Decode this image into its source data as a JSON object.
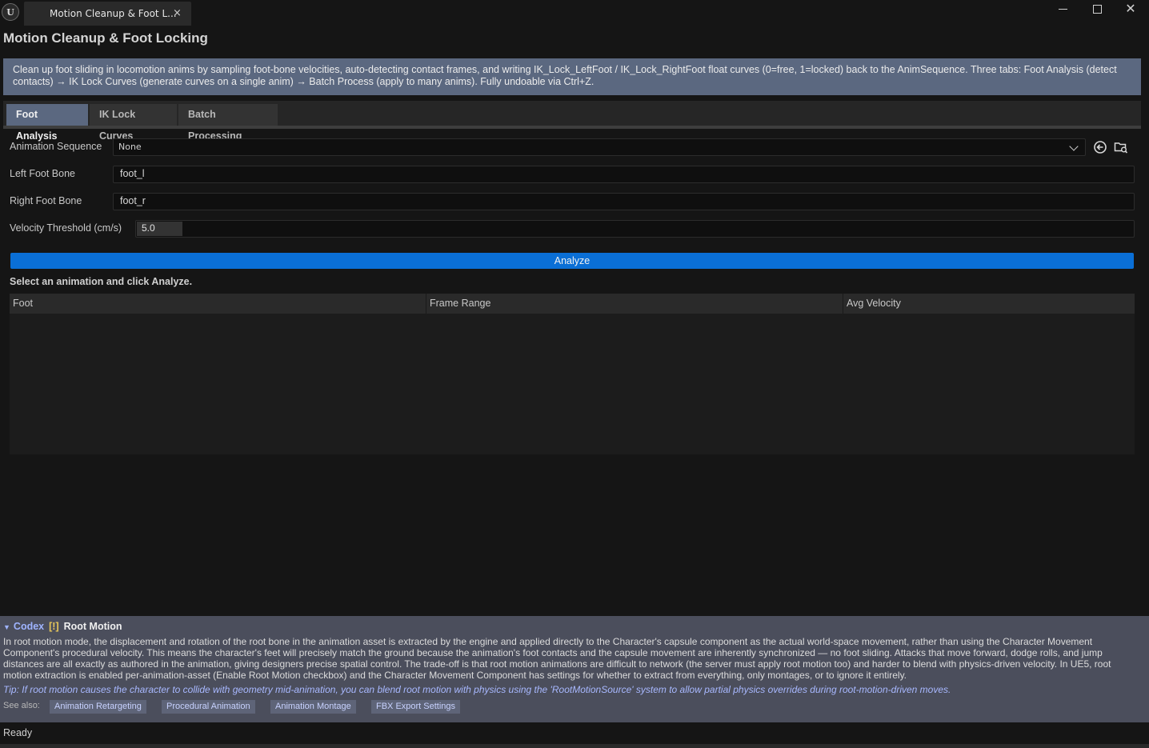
{
  "window": {
    "tab_title": "Motion Cleanup & Foot L...",
    "logo_text": "U",
    "close_glyph": "×",
    "min_glyph": "",
    "close_window_glyph": "✕"
  },
  "tool": {
    "title": "Motion Cleanup & Foot Locking",
    "description": "Clean up foot sliding in locomotion anims by sampling foot-bone velocities, auto-detecting contact frames, and writing IK_Lock_LeftFoot / IK_Lock_RightFoot float curves (0=free, 1=locked) back to the AnimSequence. Three tabs: Foot Analysis (detect contacts) → IK Lock Curves (generate curves on a single anim) → Batch Process (apply to many anims). Fully undoable via Ctrl+Z."
  },
  "tabs": [
    {
      "label": "Foot Analysis",
      "active": true
    },
    {
      "label": "IK Lock Curves",
      "active": false
    },
    {
      "label": "Batch Processing",
      "active": false
    }
  ],
  "form": {
    "anim_sequence_label": "Animation Sequence",
    "anim_sequence_value": "None",
    "left_foot_label": "Left Foot Bone",
    "left_foot_value": "foot_l",
    "right_foot_label": "Right Foot Bone",
    "right_foot_value": "foot_r",
    "velocity_label": "Velocity Threshold (cm/s)",
    "velocity_value": "5.0",
    "analyze_label": "Analyze",
    "status_message": "Select an animation and click Analyze."
  },
  "table": {
    "columns": [
      "Foot",
      "Frame Range",
      "Avg Velocity"
    ],
    "rows": []
  },
  "codex": {
    "triangle": "▼",
    "name": "Codex",
    "badge": "[!]",
    "topic": "Root Motion",
    "body": "In root motion mode, the displacement and rotation of the root bone in the animation asset is extracted by the engine and applied directly to the Character's capsule component as the actual world-space movement, rather than using the Character Movement Component's procedural velocity. This means the character's feet will precisely match the ground because the animation's foot contacts and the capsule movement are inherently synchronized — no foot sliding. Attacks that move forward, dodge rolls, and jump distances are all exactly as authored in the animation, giving designers precise spatial control. The trade-off is that root motion animations are difficult to network (the server must apply root motion too) and harder to blend with physics-driven velocity. In UE5, root motion extraction is enabled per-animation-asset (Enable Root Motion checkbox) and the Character Movement Component has settings for whether to extract from everything, only montages, or to ignore it entirely.",
    "tip": "Tip: If root motion causes the character to collide with geometry mid-animation, you can blend root motion with physics using the 'RootMotionSource' system to allow partial physics overrides during root-motion-driven moves.",
    "see_also_label": "See also:",
    "see_also": [
      "Animation Retargeting",
      "Procedural Animation",
      "Animation Montage",
      "FBX Export Settings"
    ]
  },
  "status_bar": {
    "text": "Ready"
  },
  "colors": {
    "accent_blue": "#0a6fd6",
    "tab_active": "#5b6880",
    "codex_bg": "#4b4e5c",
    "codex_link": "#9fb4ff",
    "badge": "#e8c85a"
  }
}
